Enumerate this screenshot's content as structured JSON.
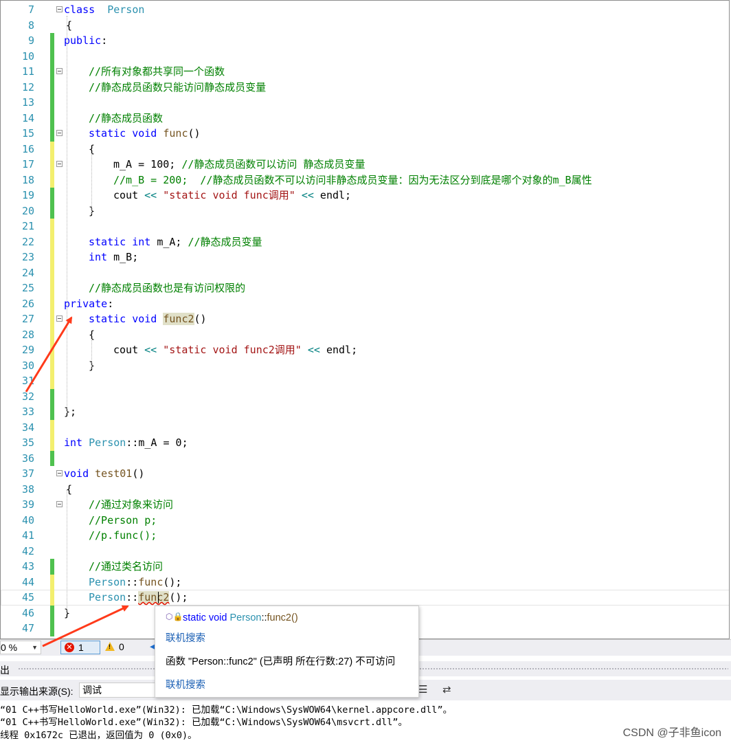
{
  "editor": {
    "lines": [
      {
        "n": "7",
        "bar": "",
        "fold": true,
        "segs": [
          [
            "kw",
            "class"
          ],
          [
            "",
            "  "
          ],
          [
            "ty",
            "Person"
          ]
        ]
      },
      {
        "n": "8",
        "bar": "",
        "fold": false,
        "segs": [
          [
            "",
            "{"
          ]
        ]
      },
      {
        "n": "9",
        "bar": "green",
        "fold": false,
        "segs": [
          [
            "kw",
            "public"
          ],
          [
            "",
            ":"
          ]
        ]
      },
      {
        "n": "10",
        "bar": "green",
        "fold": false,
        "segs": []
      },
      {
        "n": "11",
        "bar": "green",
        "fold": true,
        "segs": [
          [
            "cm",
            "//所有对象都共享同一个函数"
          ]
        ]
      },
      {
        "n": "12",
        "bar": "green",
        "fold": false,
        "segs": [
          [
            "cm",
            "//静态成员函数只能访问静态成员变量"
          ]
        ]
      },
      {
        "n": "13",
        "bar": "green",
        "fold": false,
        "segs": []
      },
      {
        "n": "14",
        "bar": "green",
        "fold": false,
        "segs": [
          [
            "cm",
            "//静态成员函数"
          ]
        ]
      },
      {
        "n": "15",
        "bar": "green",
        "fold": true,
        "segs": [
          [
            "kw",
            "static"
          ],
          [
            "",
            " "
          ],
          [
            "kw",
            "void"
          ],
          [
            "",
            " "
          ],
          [
            "fn",
            "func"
          ],
          [
            "",
            "()"
          ]
        ]
      },
      {
        "n": "16",
        "bar": "yellow",
        "fold": false,
        "segs": [
          [
            "",
            "{"
          ]
        ]
      },
      {
        "n": "17",
        "bar": "yellow",
        "fold": true,
        "segs": [
          [
            "",
            "m_A = 100; "
          ],
          [
            "cm",
            "//静态成员函数可以访问 静态成员变量"
          ]
        ]
      },
      {
        "n": "18",
        "bar": "yellow",
        "fold": false,
        "segs": [
          [
            "cm",
            "//m_B = 200;  //静态成员函数不可以访问非静态成员变量：因为无法区分到底是哪个对象的m_B属性"
          ]
        ]
      },
      {
        "n": "19",
        "bar": "green",
        "fold": false,
        "segs": [
          [
            "",
            "cout "
          ],
          [
            "op",
            "<<"
          ],
          [
            "",
            " "
          ],
          [
            "st",
            "\"static void func调用\""
          ],
          [
            "",
            " "
          ],
          [
            "op",
            "<<"
          ],
          [
            "",
            " endl;"
          ]
        ]
      },
      {
        "n": "20",
        "bar": "green",
        "fold": false,
        "segs": [
          [
            "",
            "}"
          ]
        ]
      },
      {
        "n": "21",
        "bar": "yellow",
        "fold": false,
        "segs": []
      },
      {
        "n": "22",
        "bar": "yellow",
        "fold": false,
        "segs": [
          [
            "kw",
            "static"
          ],
          [
            "",
            " "
          ],
          [
            "kw",
            "int"
          ],
          [
            "",
            " m_A; "
          ],
          [
            "cm",
            "//静态成员变量"
          ]
        ]
      },
      {
        "n": "23",
        "bar": "yellow",
        "fold": false,
        "segs": [
          [
            "kw",
            "int"
          ],
          [
            "",
            " m_B;"
          ]
        ]
      },
      {
        "n": "24",
        "bar": "yellow",
        "fold": false,
        "segs": []
      },
      {
        "n": "25",
        "bar": "yellow",
        "fold": false,
        "segs": [
          [
            "cm",
            "//静态成员函数也是有访问权限的"
          ]
        ]
      },
      {
        "n": "26",
        "bar": "yellow",
        "fold": false,
        "segs": [
          [
            "kw",
            "private"
          ],
          [
            "",
            ":"
          ]
        ]
      },
      {
        "n": "27",
        "bar": "yellow",
        "fold": true,
        "segs": [
          [
            "kw",
            "static"
          ],
          [
            "",
            " "
          ],
          [
            "kw",
            "void"
          ],
          [
            "",
            " "
          ],
          [
            "fn hl",
            "func2"
          ],
          [
            "",
            "()"
          ]
        ]
      },
      {
        "n": "28",
        "bar": "yellow",
        "fold": false,
        "segs": [
          [
            "",
            "{"
          ]
        ]
      },
      {
        "n": "29",
        "bar": "yellow",
        "fold": false,
        "segs": [
          [
            "",
            "cout "
          ],
          [
            "op",
            "<<"
          ],
          [
            "",
            " "
          ],
          [
            "st",
            "\"static void func2调用\""
          ],
          [
            "",
            " "
          ],
          [
            "op",
            "<<"
          ],
          [
            "",
            " endl;"
          ]
        ]
      },
      {
        "n": "30",
        "bar": "yellow",
        "fold": false,
        "segs": [
          [
            "",
            "}"
          ]
        ]
      },
      {
        "n": "31",
        "bar": "yellow",
        "fold": false,
        "segs": []
      },
      {
        "n": "32",
        "bar": "green",
        "fold": false,
        "segs": []
      },
      {
        "n": "33",
        "bar": "green",
        "fold": false,
        "segs": [
          [
            "",
            "};"
          ]
        ]
      },
      {
        "n": "34",
        "bar": "yellow",
        "fold": false,
        "segs": []
      },
      {
        "n": "35",
        "bar": "yellow",
        "fold": false,
        "segs": [
          [
            "kw",
            "int"
          ],
          [
            "",
            " "
          ],
          [
            "ty",
            "Person"
          ],
          [
            "",
            "::m_A = 0;"
          ]
        ]
      },
      {
        "n": "36",
        "bar": "green",
        "fold": false,
        "segs": []
      },
      {
        "n": "37",
        "bar": "",
        "fold": true,
        "segs": [
          [
            "kw",
            "void"
          ],
          [
            "",
            " "
          ],
          [
            "fn",
            "test01"
          ],
          [
            "",
            "()"
          ]
        ]
      },
      {
        "n": "38",
        "bar": "",
        "fold": false,
        "segs": [
          [
            "",
            "{"
          ]
        ]
      },
      {
        "n": "39",
        "bar": "",
        "fold": true,
        "segs": [
          [
            "cm",
            "//通过对象来访问"
          ]
        ]
      },
      {
        "n": "40",
        "bar": "",
        "fold": false,
        "segs": [
          [
            "cm",
            "//Person p;"
          ]
        ]
      },
      {
        "n": "41",
        "bar": "",
        "fold": false,
        "segs": [
          [
            "cm",
            "//p.func();"
          ]
        ]
      },
      {
        "n": "42",
        "bar": "",
        "fold": false,
        "segs": []
      },
      {
        "n": "43",
        "bar": "green",
        "fold": false,
        "segs": [
          [
            "cm",
            "//通过类名访问"
          ]
        ]
      },
      {
        "n": "44",
        "bar": "yellow",
        "fold": false,
        "segs": [
          [
            "ty",
            "Person"
          ],
          [
            "",
            "::"
          ],
          [
            "fn",
            "func"
          ],
          [
            "",
            "();"
          ]
        ]
      },
      {
        "n": "45",
        "bar": "yellow",
        "fold": false,
        "segs": [
          [
            "ty",
            "Person"
          ],
          [
            "",
            "::"
          ],
          [
            "fn hl err",
            "func2"
          ],
          [
            "",
            "();"
          ]
        ]
      },
      {
        "n": "46",
        "bar": "green",
        "fold": false,
        "segs": [
          [
            "",
            "}"
          ]
        ]
      },
      {
        "n": "47",
        "bar": "green",
        "fold": false,
        "segs": []
      }
    ]
  },
  "statusbar": {
    "zoom": "0 %",
    "errors": "1",
    "warnings": "0"
  },
  "tooltip": {
    "signature_keyword": "static void ",
    "signature_class": "Person",
    "signature_sep": "::",
    "signature_fn": "func2()",
    "link1": "联机搜索",
    "message": "函数 \"Person::func2\" (已声明 所在行数:27) 不可访问",
    "link2": "联机搜索"
  },
  "output": {
    "title": "出",
    "source_label": "显示输出来源(S):",
    "source_value": "调试",
    "lines": [
      "“01 C++书写HelloWorld.exe”(Win32): 已加载“C:\\Windows\\SysWOW64\\kernel.appcore.dll”。",
      "“01 C++书写HelloWorld.exe”(Win32): 已加载“C:\\Windows\\SysWOW64\\msvcrt.dll”。",
      "线程 0x1672c 已退出，返回值为 0 (0x0)。"
    ]
  },
  "watermark": "CSDN @子非鱼icon",
  "colors": {
    "bar_green": "#4fc14f",
    "bar_yellow": "#f3ef6e",
    "arrow": "#ff3a1a"
  }
}
